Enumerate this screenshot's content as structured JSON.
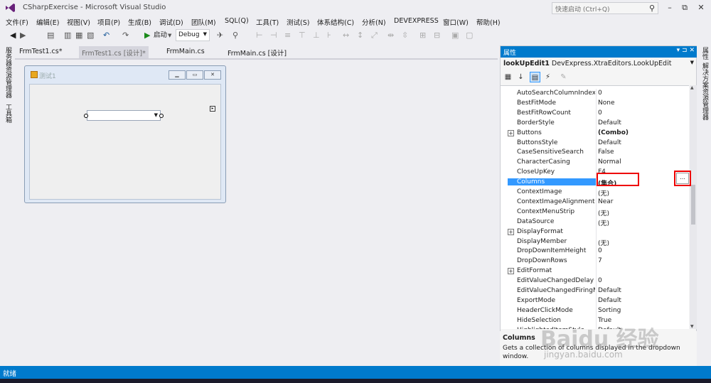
{
  "app": {
    "title": "CSharpExercise - Microsoft Visual Studio",
    "quick_launch_placeholder": "快速启动 (Ctrl+Q)"
  },
  "menu": [
    "文件(F)",
    "编辑(E)",
    "视图(V)",
    "项目(P)",
    "生成(B)",
    "调试(D)",
    "团队(M)",
    "SQL(Q)",
    "工具(T)",
    "测试(S)",
    "体系结构(C)",
    "分析(N)",
    "DEVEXPRESS",
    "窗口(W)",
    "帮助(H)"
  ],
  "toolbar": {
    "start_label": "启动",
    "config_label": "Debug"
  },
  "left_strip": [
    "服务器资源管理器",
    "工具箱"
  ],
  "right_strip": [
    "属性",
    "解决方案资源管理器"
  ],
  "doc_tabs": [
    {
      "label": "FrmTest1.cs*"
    },
    {
      "label": "FrmTest1.cs [设计]*"
    },
    {
      "label": "FrmMain.cs"
    },
    {
      "label": "FrmMain.cs [设计]"
    }
  ],
  "designer": {
    "form_title": "测试1"
  },
  "properties": {
    "panel_title": "属性",
    "object_name": "lookUpEdit1",
    "object_type": "DevExpress.XtraEditors.LookUpEdit",
    "rows": [
      {
        "name": "AutoSearchColumnIndex",
        "value": "0",
        "exp": ""
      },
      {
        "name": "BestFitMode",
        "value": "None",
        "exp": ""
      },
      {
        "name": "BestFitRowCount",
        "value": "0",
        "exp": ""
      },
      {
        "name": "BorderStyle",
        "value": "Default",
        "exp": ""
      },
      {
        "name": "Buttons",
        "value": "(Combo)",
        "exp": "+"
      },
      {
        "name": "ButtonsStyle",
        "value": "Default",
        "exp": ""
      },
      {
        "name": "CaseSensitiveSearch",
        "value": "False",
        "exp": ""
      },
      {
        "name": "CharacterCasing",
        "value": "Normal",
        "exp": ""
      },
      {
        "name": "CloseUpKey",
        "value": "F4",
        "exp": ""
      },
      {
        "name": "Columns",
        "value": "(集合)",
        "exp": ""
      },
      {
        "name": "ContextImage",
        "value": "(无)",
        "exp": ""
      },
      {
        "name": "ContextImageAlignment",
        "value": "Near",
        "exp": ""
      },
      {
        "name": "ContextMenuStrip",
        "value": "(无)",
        "exp": ""
      },
      {
        "name": "DataSource",
        "value": "(无)",
        "exp": ""
      },
      {
        "name": "DisplayFormat",
        "value": "",
        "exp": "+"
      },
      {
        "name": "DisplayMember",
        "value": "(无)",
        "exp": ""
      },
      {
        "name": "DropDownItemHeight",
        "value": "0",
        "exp": ""
      },
      {
        "name": "DropDownRows",
        "value": "7",
        "exp": ""
      },
      {
        "name": "EditFormat",
        "value": "",
        "exp": "+"
      },
      {
        "name": "EditValueChangedDelay",
        "value": "0",
        "exp": ""
      },
      {
        "name": "EditValueChangedFiringM",
        "value": "Default",
        "exp": ""
      },
      {
        "name": "ExportMode",
        "value": "Default",
        "exp": ""
      },
      {
        "name": "HeaderClickMode",
        "value": "Sorting",
        "exp": ""
      },
      {
        "name": "HideSelection",
        "value": "True",
        "exp": ""
      },
      {
        "name": "HighlightedItemStyle",
        "value": "Default",
        "exp": ""
      }
    ],
    "selected_index": 9,
    "ellipsis": "...",
    "description_title": "Columns",
    "description_text": "Gets a collection of columns displayed in the dropdown window."
  },
  "status": {
    "text": "就绪"
  },
  "watermark": {
    "text": "Baidu 经验",
    "url": "jingyan.baidu.com"
  },
  "colors": {
    "accent": "#007acc",
    "selection": "#3399ff",
    "highlight_box": "#ee0000"
  }
}
